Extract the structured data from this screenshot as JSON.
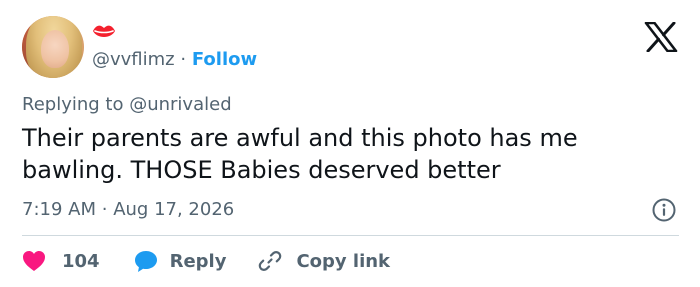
{
  "user": {
    "handle": "@vvflimz",
    "separator": "·",
    "follow_label": "Follow"
  },
  "replying": {
    "prefix": "Replying to",
    "target": "@unrivaled"
  },
  "tweet": {
    "text": "Their parents are awful and this photo has me\nbawling. THOSE Babies deserved better"
  },
  "meta": {
    "time": "7:19 AM",
    "separator": "·",
    "date": "Aug 17, 2026"
  },
  "actions": {
    "like_count": "104",
    "reply_label": "Reply",
    "copy_label": "Copy link"
  },
  "icons": {
    "avatar": "profile-photo",
    "badge": "kiss-lips-icon",
    "logo": "x-logo-icon",
    "info": "info-icon",
    "like": "heart-icon",
    "reply": "chat-bubble-icon",
    "copy": "link-icon"
  },
  "colors": {
    "text": "#0f1419",
    "secondary": "#536471",
    "accent": "#1d9bf0",
    "like": "#f91880",
    "divider": "#cfd9de",
    "lips": "#f4212e"
  }
}
